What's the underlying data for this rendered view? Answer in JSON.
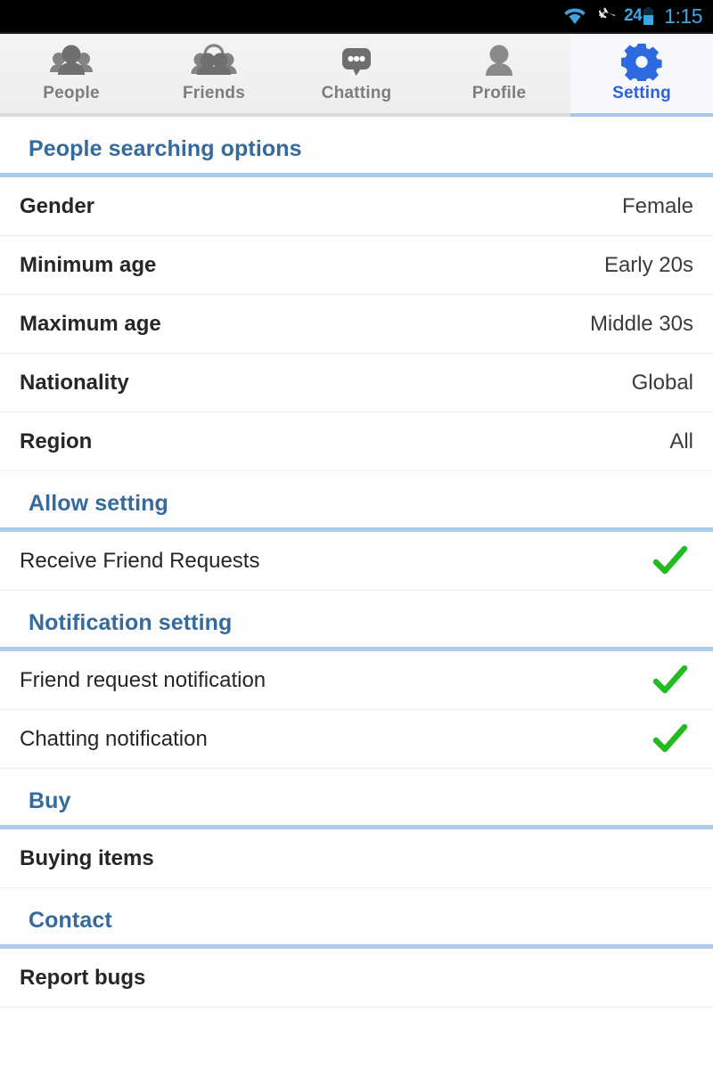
{
  "statusbar": {
    "wifi_icon": "wifi-icon",
    "airplane_icon": "airplane-mode-icon",
    "battery_level": "24",
    "battery_icon": "battery-icon",
    "time": "1:15"
  },
  "tabs": [
    {
      "label": "People",
      "icon": "people-icon",
      "active": false
    },
    {
      "label": "Friends",
      "icon": "friends-icon",
      "active": false
    },
    {
      "label": "Chatting",
      "icon": "chat-bubble-icon",
      "active": false
    },
    {
      "label": "Profile",
      "icon": "profile-person-icon",
      "active": false
    },
    {
      "label": "Setting",
      "icon": "gear-icon",
      "active": true
    }
  ],
  "sections": [
    {
      "title": "People searching options",
      "rows": [
        {
          "label": "Gender",
          "value": "Female",
          "bold": true
        },
        {
          "label": "Minimum age",
          "value": "Early 20s",
          "bold": true
        },
        {
          "label": "Maximum age",
          "value": "Middle 30s",
          "bold": true
        },
        {
          "label": "Nationality",
          "value": "Global",
          "bold": true
        },
        {
          "label": "Region",
          "value": "All",
          "bold": true
        }
      ]
    },
    {
      "title": "Allow setting",
      "rows": [
        {
          "label": "Receive Friend Requests",
          "value": "",
          "bold": false,
          "checked": true
        }
      ]
    },
    {
      "title": "Notification setting",
      "rows": [
        {
          "label": "Friend request notification",
          "value": "",
          "bold": false,
          "checked": true
        },
        {
          "label": "Chatting notification",
          "value": "",
          "bold": false,
          "checked": true
        }
      ]
    },
    {
      "title": "Buy",
      "rows": [
        {
          "label": "Buying items",
          "value": "",
          "bold": true
        }
      ]
    },
    {
      "title": "Contact",
      "rows": [
        {
          "label": "Report bugs",
          "value": "",
          "bold": true
        }
      ]
    }
  ],
  "colors": {
    "accent_blue": "#2f5fe0",
    "header_blue": "#356a9c",
    "rule_blue": "#abcbea",
    "check_green": "#22bb22",
    "status_blue": "#3ea6df"
  }
}
